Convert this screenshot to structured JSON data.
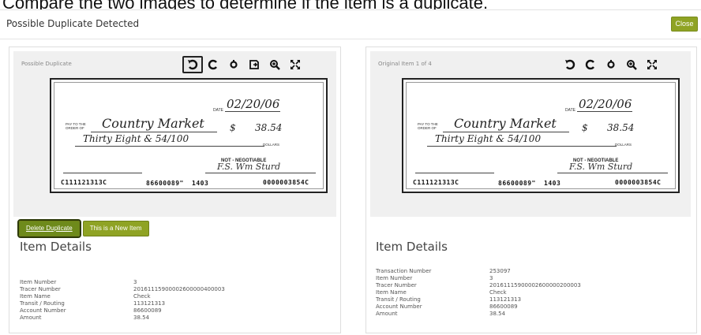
{
  "instruction": "Compare the two images to determine if the item is a duplicate.",
  "dialog": {
    "title": "Possible Duplicate Detected",
    "close_label": "Close"
  },
  "left": {
    "viewer_label": "Possible Duplicate",
    "tools": [
      "rotate-ccw-icon",
      "rotate-cw-icon",
      "reset-icon",
      "flip-icon",
      "zoom-in-icon",
      "fullscreen-icon"
    ],
    "check": {
      "date_label": "DATE",
      "date": "02/20/06",
      "pay_label": "PAY TO THE ORDER OF",
      "payee": "Country Market",
      "dollar": "$",
      "amount": "38.54",
      "words": "Thirty Eight & 54/100",
      "dollars_label": "DOLLARS",
      "neg": "NOT - NEGOTIABLE",
      "signature": "F.S. Wm Sturd",
      "micr_routing": "C111121313C",
      "micr_account": "86600089\"",
      "micr_serial": "1403",
      "micr_amount": "0000003854C"
    },
    "buttons": {
      "delete": "Delete Duplicate",
      "new_item": "This is a New Item"
    },
    "details_title": "Item Details",
    "details": [
      {
        "key": "Item Number",
        "value": "3"
      },
      {
        "key": "Tracer Number",
        "value": "20161115900002600000400003"
      },
      {
        "key": "Item Name",
        "value": "Check"
      },
      {
        "key": "Transit / Routing",
        "value": "113121313"
      },
      {
        "key": "Account Number",
        "value": "86600089"
      },
      {
        "key": "Amount",
        "value": "38.54"
      }
    ]
  },
  "right": {
    "viewer_label": "Original Item 1 of 4",
    "tools": [
      "rotate-ccw-icon",
      "rotate-cw-icon",
      "reset-icon",
      "zoom-in-icon",
      "fullscreen-icon"
    ],
    "check": {
      "date_label": "DATE",
      "date": "02/20/06",
      "pay_label": "PAY TO THE ORDER OF",
      "payee": "Country Market",
      "dollar": "$",
      "amount": "38.54",
      "words": "Thirty Eight & 54/100",
      "dollars_label": "DOLLARS",
      "neg": "NOT - NEGOTIABLE",
      "signature": "F.S. Wm Sturd",
      "micr_routing": "C111121313C",
      "micr_account": "86600089\"",
      "micr_serial": "1403",
      "micr_amount": "0000003854C"
    },
    "details_title": "Item Details",
    "details": [
      {
        "key": "Transaction Number",
        "value": "253097"
      },
      {
        "key": "Item Number",
        "value": "3"
      },
      {
        "key": "Tracer Number",
        "value": "20161115900002600000200003"
      },
      {
        "key": "Item Name",
        "value": "Check"
      },
      {
        "key": "Transit / Routing",
        "value": "113121313"
      },
      {
        "key": "Account Number",
        "value": "86600089"
      },
      {
        "key": "Amount",
        "value": "38.54"
      }
    ]
  }
}
